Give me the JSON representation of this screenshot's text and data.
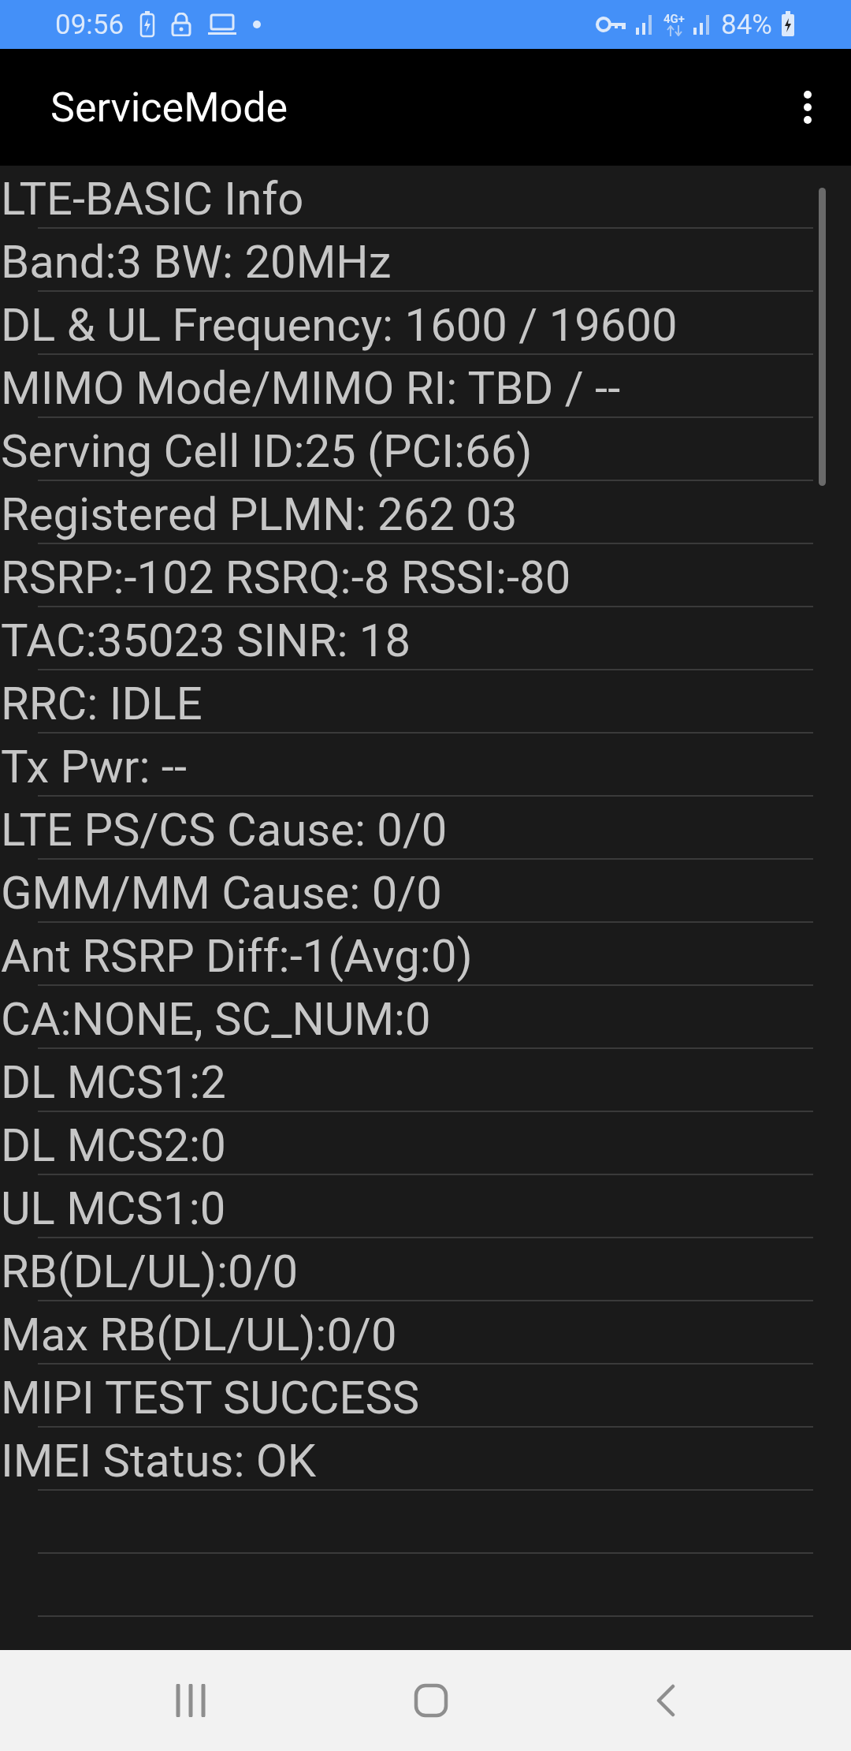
{
  "status_bar": {
    "time": "09:56",
    "network_type": "4G+",
    "battery": "84%"
  },
  "app_bar": {
    "title": "ServiceMode"
  },
  "info_lines": [
    "LTE-BASIC Info",
    "Band:3 BW: 20MHz",
    "DL & UL Frequency: 1600 / 19600",
    "MIMO Mode/MIMO RI: TBD / --",
    "Serving Cell ID:25 (PCI:66)",
    "Registered PLMN: 262 03",
    "RSRP:-102 RSRQ:-8 RSSI:-80",
    "TAC:35023 SINR: 18",
    "RRC: IDLE",
    "Tx Pwr: --",
    "LTE PS/CS Cause: 0/0",
    "GMM/MM Cause: 0/0",
    "Ant RSRP Diff:-1(Avg:0)",
    "CA:NONE, SC_NUM:0",
    "DL MCS1:2",
    "DL MCS2:0",
    "UL MCS1:0",
    "RB(DL/UL):0/0",
    "Max RB(DL/UL):0/0",
    "MIPI TEST SUCCESS",
    "IMEI Status: OK"
  ]
}
